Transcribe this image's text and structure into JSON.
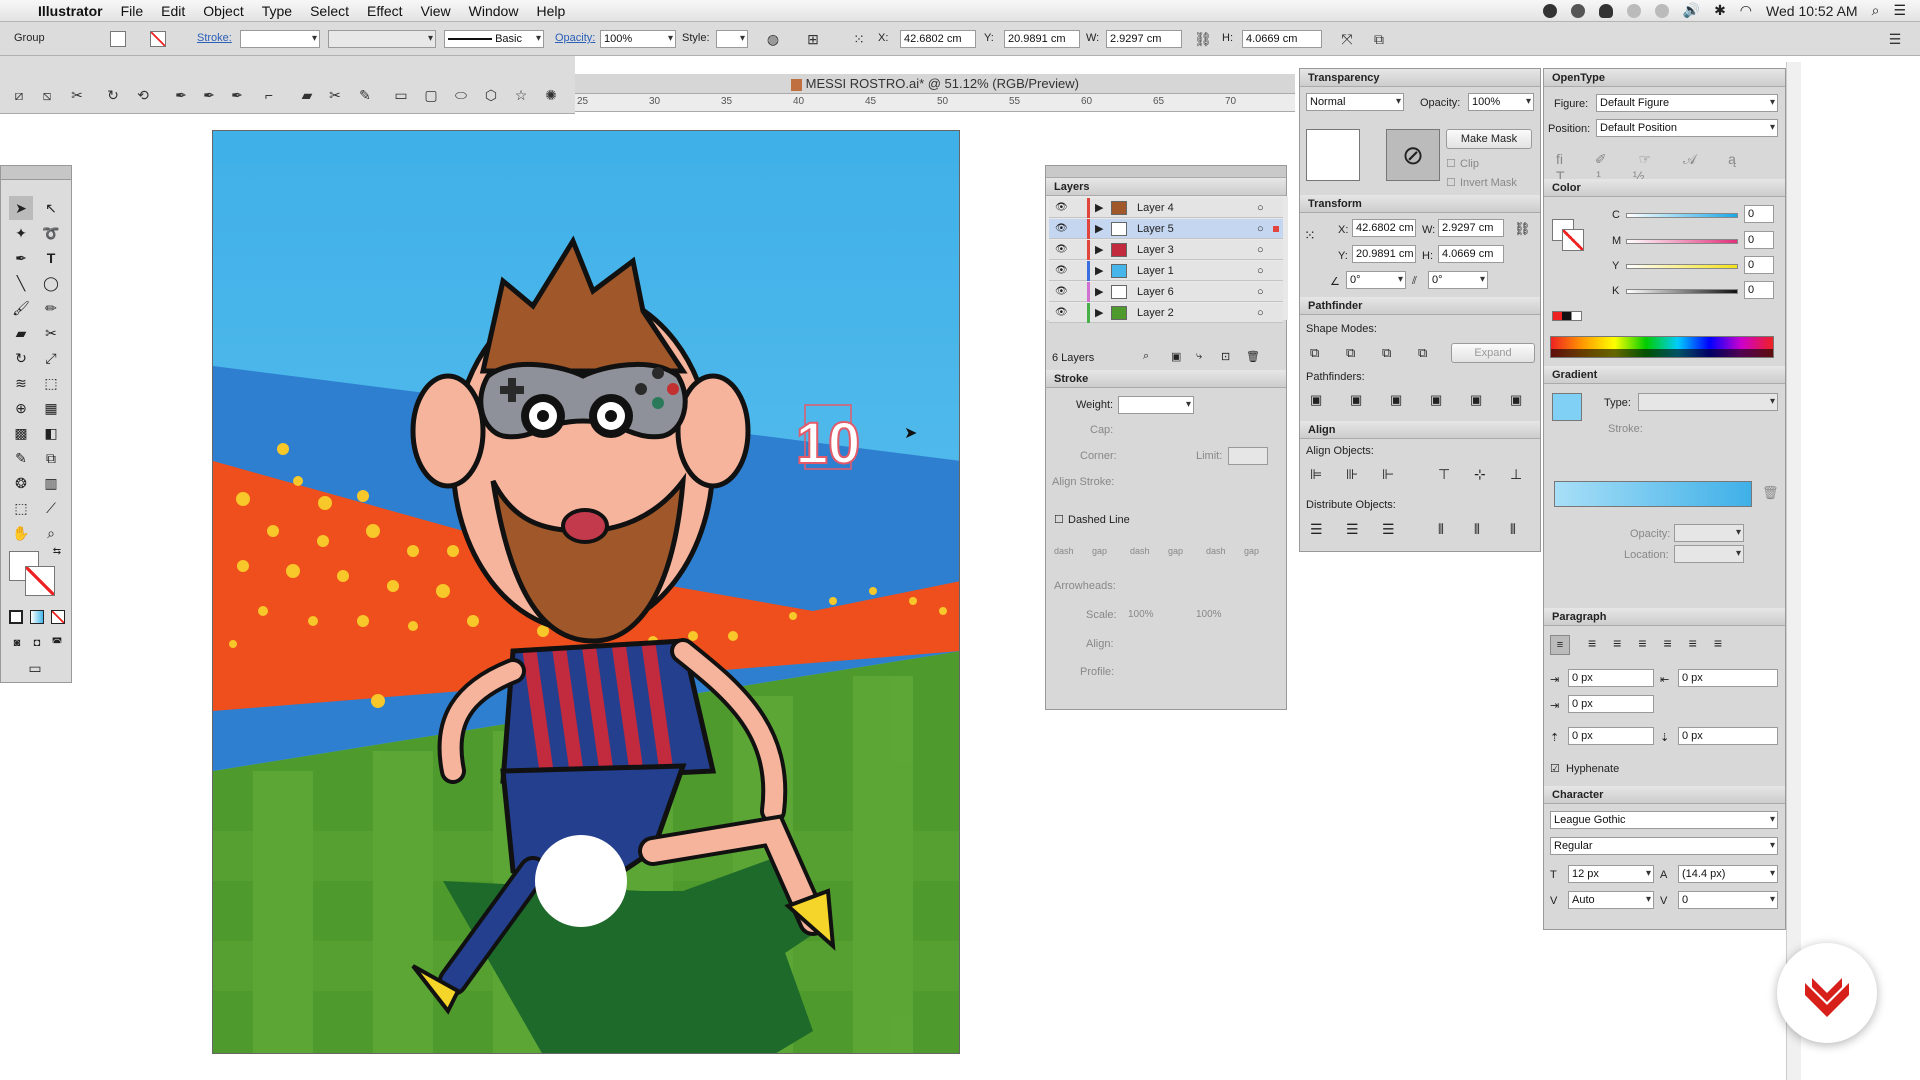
{
  "menubar": {
    "app": "Illustrator",
    "items": [
      "File",
      "Edit",
      "Object",
      "Type",
      "Select",
      "Effect",
      "View",
      "Window",
      "Help"
    ],
    "clock": "Wed 10:52 AM"
  },
  "control": {
    "selection": "Group",
    "stroke_label": "Stroke:",
    "brush": "Basic",
    "opacity_label": "Opacity:",
    "opacity": "100%",
    "style_label": "Style:",
    "x_label": "X:",
    "x": "42.6802 cm",
    "y_label": "Y:",
    "y": "20.9891 cm",
    "w_label": "W:",
    "w": "2.9297 cm",
    "h_label": "H:",
    "h": "4.0669 cm"
  },
  "document": {
    "tab": "MESSI ROSTRO.ai* @ 51.12% (RGB/Preview)",
    "ruler": [
      "25",
      "30",
      "35",
      "40",
      "45",
      "50",
      "55",
      "60",
      "65",
      "70"
    ]
  },
  "artwork": {
    "jersey_number": "10"
  },
  "layers": {
    "title": "Layers",
    "count": "6 Layers",
    "items": [
      {
        "name": "Layer 4",
        "color": "#e0443c"
      },
      {
        "name": "Layer 5",
        "color": "#e0443c",
        "selected": true
      },
      {
        "name": "Layer 3",
        "color": "#e0443c"
      },
      {
        "name": "Layer 1",
        "color": "#3a6ee0"
      },
      {
        "name": "Layer 6",
        "color": "#d070d0"
      },
      {
        "name": "Layer 2",
        "color": "#48b048"
      }
    ]
  },
  "stroke": {
    "title": "Stroke",
    "weight": "Weight:",
    "cap": "Cap:",
    "corner": "Corner:",
    "limit": "Limit:",
    "align": "Align Stroke:",
    "dashed": "Dashed Line",
    "dash_labels": [
      "dash",
      "gap",
      "dash",
      "gap",
      "dash",
      "gap"
    ],
    "arrowheads": "Arrowheads:",
    "scale": "Scale:",
    "scale_a": "100%",
    "scale_b": "100%",
    "align2": "Align:",
    "profile": "Profile:"
  },
  "transparency": {
    "title": "Transparency",
    "mode": "Normal",
    "opacity_label": "Opacity:",
    "opacity": "100%",
    "make_mask": "Make Mask",
    "clip": "Clip",
    "invert": "Invert Mask"
  },
  "transform": {
    "title": "Transform",
    "x_label": "X:",
    "x": "42.6802 cm",
    "w_label": "W:",
    "w": "2.9297 cm",
    "y_label": "Y:",
    "y": "20.9891 cm",
    "h_label": "H:",
    "h": "4.0669 cm",
    "angle": "0°",
    "shear": "0°"
  },
  "pathfinder": {
    "title": "Pathfinder",
    "shape_modes": "Shape Modes:",
    "expand": "Expand",
    "pathfinders": "Pathfinders:"
  },
  "align": {
    "title": "Align",
    "align_objects": "Align Objects:",
    "distribute": "Distribute Objects:"
  },
  "opentype": {
    "title": "OpenType",
    "figure_label": "Figure:",
    "figure": "Default Figure",
    "position_label": "Position:",
    "position": "Default Position"
  },
  "color": {
    "title": "Color",
    "channels": [
      {
        "l": "C",
        "v": "0",
        "c": "#1aa7e6"
      },
      {
        "l": "M",
        "v": "0",
        "c": "#e0307a"
      },
      {
        "l": "Y",
        "v": "0",
        "c": "#f2e01a"
      },
      {
        "l": "K",
        "v": "0",
        "c": "#111111"
      }
    ]
  },
  "gradient": {
    "title": "Gradient",
    "type_label": "Type:",
    "stroke_label": "Stroke:",
    "opacity_label": "Opacity:",
    "location_label": "Location:"
  },
  "paragraph": {
    "title": "Paragraph",
    "v1": "0 px",
    "v2": "0 px",
    "v3": "0 px",
    "v4": "0 px",
    "v5": "0 px",
    "hyphenate": "Hyphenate"
  },
  "character": {
    "title": "Character",
    "font": "League Gothic",
    "style": "Regular",
    "size": "12 px",
    "leading": "(14.4 px)",
    "kerning": "Auto",
    "tracking": "0"
  }
}
